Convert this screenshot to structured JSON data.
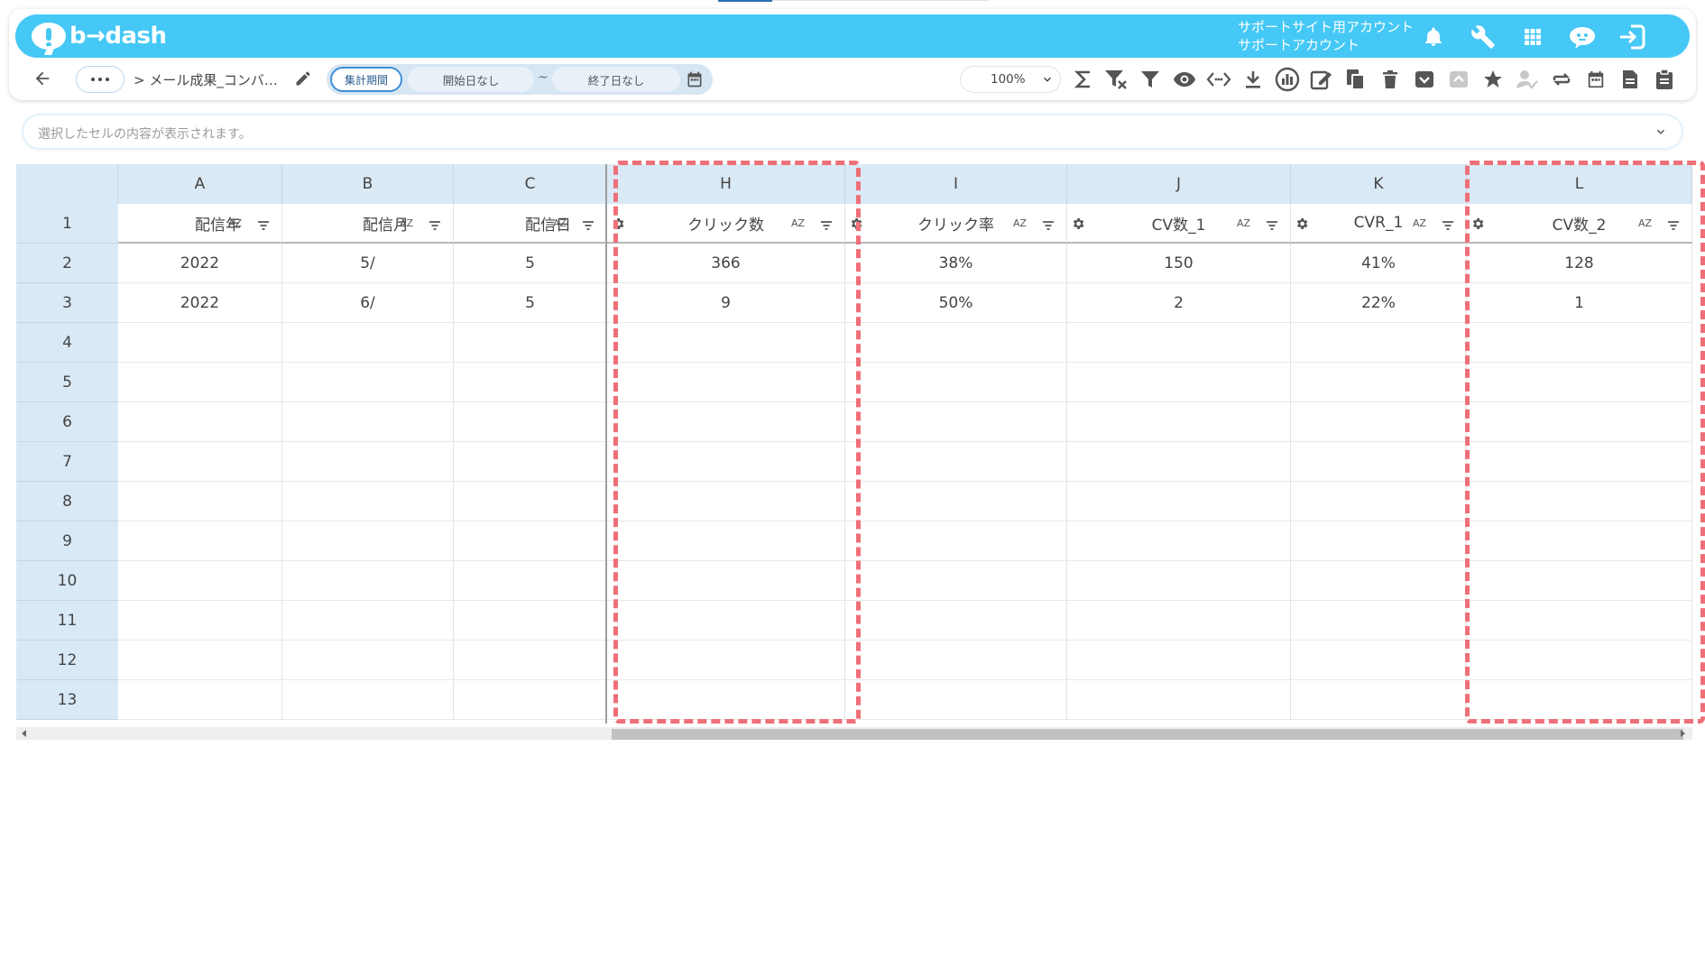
{
  "app": {
    "brand": "b→dash",
    "account_line1": "サポートサイト用アカウント",
    "account_line2": "サポートアカウント"
  },
  "toolbar": {
    "breadcrumb": "> メール成果_コンバ…",
    "period_label": "集計期間",
    "start_date": "開始日なし",
    "tilde": "~",
    "end_date": "終了日なし",
    "zoom": "100%"
  },
  "formula_bar": {
    "placeholder": "選択したセルの内容が表示されます。"
  },
  "grid": {
    "columns": [
      "A",
      "B",
      "C",
      "H",
      "I",
      "J",
      "K",
      "L"
    ],
    "rows": [
      "1",
      "2",
      "3",
      "4",
      "5",
      "6",
      "7",
      "8",
      "9",
      "10",
      "11",
      "12",
      "13"
    ],
    "header_row": [
      "配信年",
      "配信月",
      "配信日",
      "クリック数",
      "クリック率",
      "CV数_1",
      "CVR_1",
      "CV数_2"
    ],
    "sort_label": "AZ",
    "data": [
      [
        "2022",
        "5/",
        "5",
        "366",
        "38%",
        "150",
        "41%",
        "128"
      ],
      [
        "2022",
        "6/",
        "5",
        "9",
        "50%",
        "2",
        "22%",
        "1"
      ]
    ]
  },
  "colors": {
    "header_blue": "#45c8f5",
    "highlight_red": "#ef6f78",
    "grid_header": "#d9e9f6"
  },
  "icons": {
    "header": [
      "bell-icon",
      "wrench-icon",
      "apps-grid-icon",
      "chat-bot-icon",
      "logout-icon"
    ],
    "toolbar": [
      "sum-icon",
      "filter-clear-icon",
      "filter-icon",
      "eye-icon",
      "code-icon",
      "download-icon",
      "chart-icon",
      "edit-note-icon",
      "copy-icon",
      "trash-icon",
      "archive-icon",
      "archive-disabled-icon",
      "star-icon",
      "user-check-icon",
      "refresh-icon",
      "calendar-icon",
      "document-icon",
      "clipboard-icon"
    ]
  }
}
